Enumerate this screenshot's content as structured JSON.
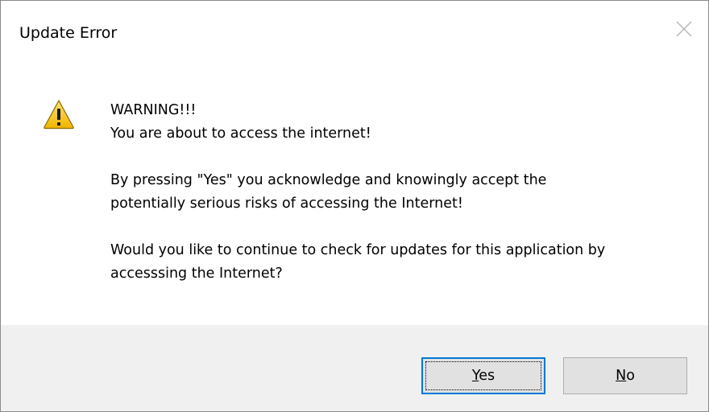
{
  "window": {
    "title": "Update Error",
    "close_glyph": "close-icon"
  },
  "message": {
    "icon": "warning-icon",
    "lines": [
      "WARNING!!!",
      "You are about to access the internet!",
      "By pressing \"Yes\" you acknowledge and knowingly accept the",
      "potentially serious risks of accessing the Internet!",
      "Would you like to continue to check for updates for this application by",
      "accesssing the Internet?"
    ]
  },
  "buttons": {
    "yes": {
      "accel": "Y",
      "rest": "es",
      "is_default": true
    },
    "no": {
      "accel": "N",
      "rest": "o",
      "is_default": false
    }
  },
  "colors": {
    "accent": "#0078d7",
    "footer_bg": "#f0f0f0",
    "warning_fill": "#f5c400"
  }
}
